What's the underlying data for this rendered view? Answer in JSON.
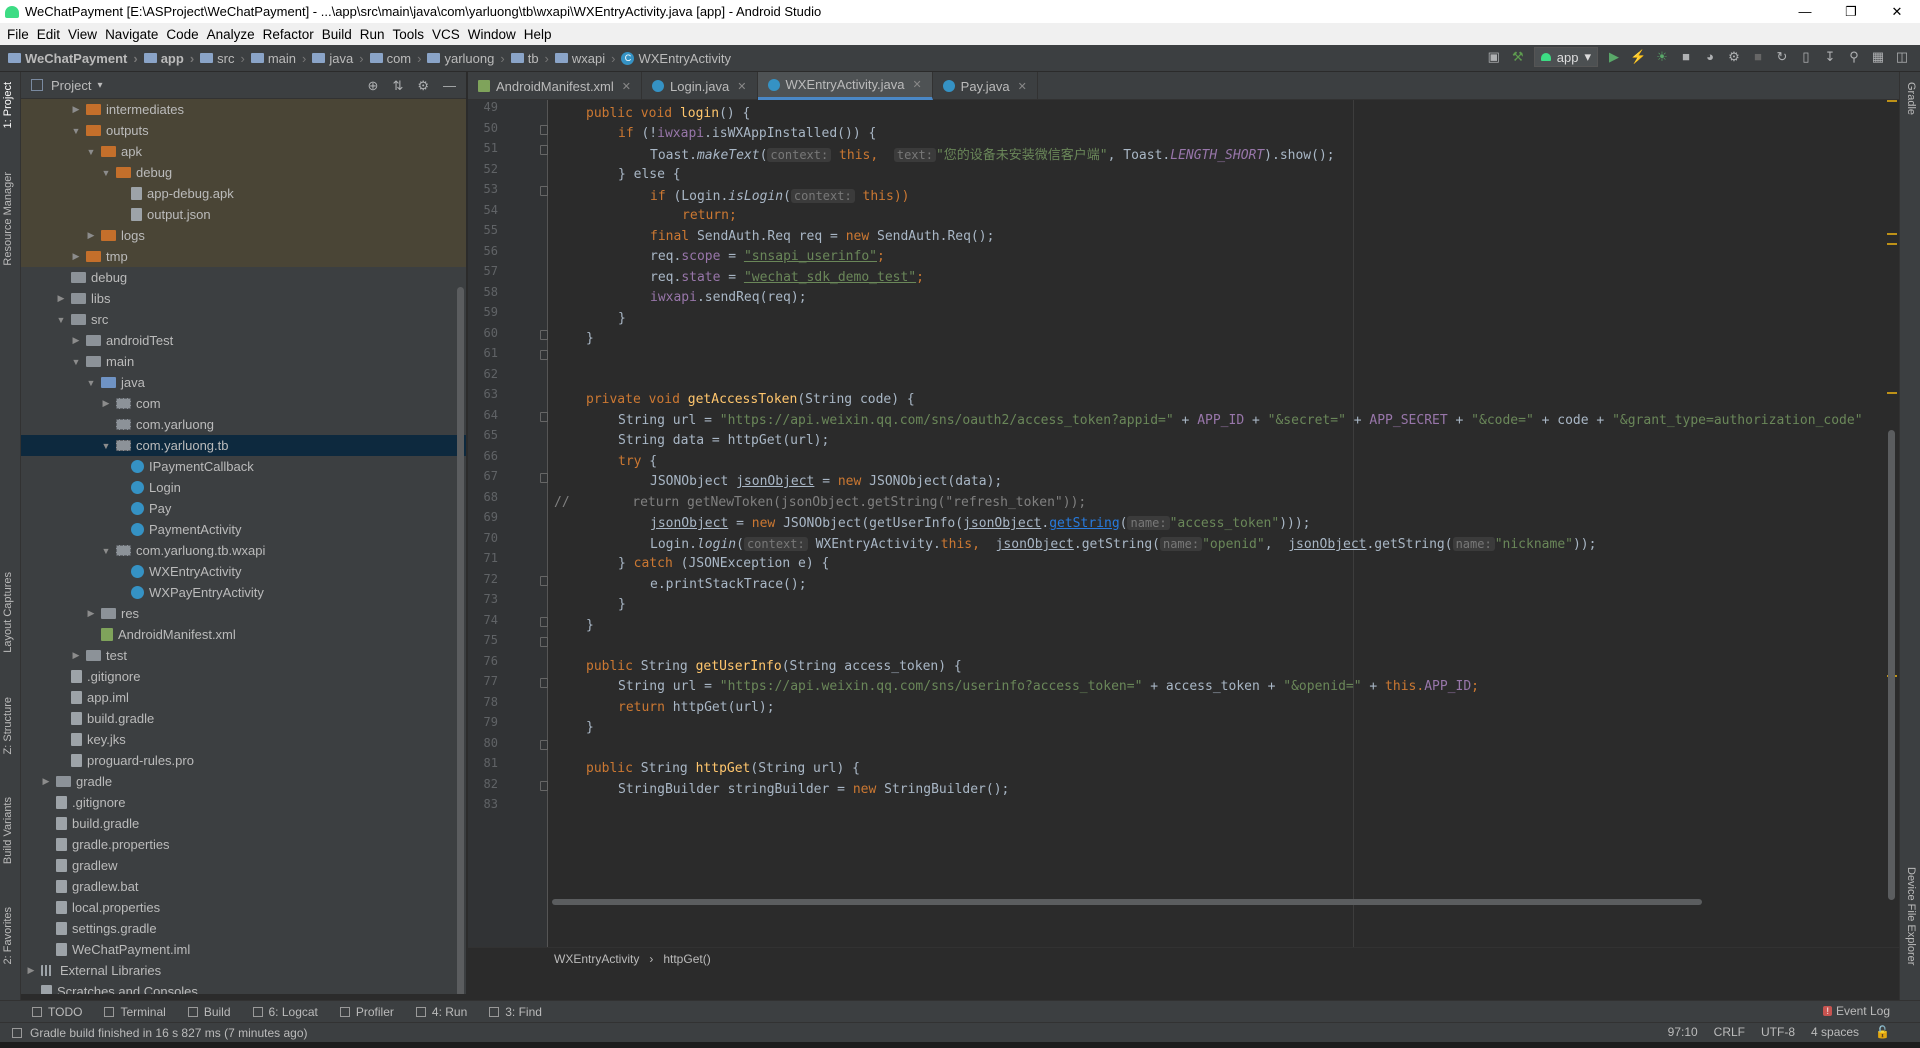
{
  "window": {
    "title": "WeChatPayment [E:\\ASProject\\WeChatPayment] - ...\\app\\src\\main\\java\\com\\yarluong\\tb\\wxapi\\WXEntryActivity.java [app] - Android Studio"
  },
  "menu": [
    "File",
    "Edit",
    "View",
    "Navigate",
    "Code",
    "Analyze",
    "Refactor",
    "Build",
    "Run",
    "Tools",
    "VCS",
    "Window",
    "Help"
  ],
  "breadcrumbs": [
    "WeChatPayment",
    "app",
    "src",
    "main",
    "java",
    "com",
    "yarluong",
    "tb",
    "wxapi",
    "WXEntryActivity"
  ],
  "run_config": "app",
  "left_tool_tabs": [
    "1: Project",
    "Resource Manager",
    "Layout Captures",
    "Z: Structure",
    "Build Variants",
    "2: Favorites"
  ],
  "right_tool_tabs": [
    "Gradle",
    "Device File Explorer"
  ],
  "project_panel": {
    "title": "Project",
    "tree": [
      {
        "label": "intermediates",
        "icon": "folder-orange",
        "arrow": "right"
      },
      {
        "label": "outputs",
        "icon": "folder-orange",
        "arrow": "down"
      },
      {
        "label": "apk",
        "icon": "folder-orange",
        "arrow": "down"
      },
      {
        "label": "debug",
        "icon": "folder-orange",
        "arrow": "down"
      },
      {
        "label": "app-debug.apk",
        "icon": "file",
        "arrow": ""
      },
      {
        "label": "output.json",
        "icon": "file",
        "arrow": ""
      },
      {
        "label": "logs",
        "icon": "folder-orange",
        "arrow": "right"
      },
      {
        "label": "tmp",
        "icon": "folder-orange",
        "arrow": "right"
      },
      {
        "label": "debug",
        "icon": "folder-gray",
        "arrow": ""
      },
      {
        "label": "libs",
        "icon": "folder-gray",
        "arrow": "right"
      },
      {
        "label": "src",
        "icon": "folder-gray",
        "arrow": "down"
      },
      {
        "label": "androidTest",
        "icon": "folder-gray",
        "arrow": "right"
      },
      {
        "label": "main",
        "icon": "folder-gray",
        "arrow": "down"
      },
      {
        "label": "java",
        "icon": "folder-blue",
        "arrow": "down"
      },
      {
        "label": "com",
        "icon": "package",
        "arrow": "right"
      },
      {
        "label": "com.yarluong",
        "icon": "package",
        "arrow": ""
      },
      {
        "label": "com.yarluong.tb",
        "icon": "package",
        "arrow": "down"
      },
      {
        "label": "IPaymentCallback",
        "icon": "class",
        "arrow": ""
      },
      {
        "label": "Login",
        "icon": "class",
        "arrow": ""
      },
      {
        "label": "Pay",
        "icon": "class",
        "arrow": ""
      },
      {
        "label": "PaymentActivity",
        "icon": "class",
        "arrow": ""
      },
      {
        "label": "com.yarluong.tb.wxapi",
        "icon": "package",
        "arrow": "down"
      },
      {
        "label": "WXEntryActivity",
        "icon": "class",
        "arrow": ""
      },
      {
        "label": "WXPayEntryActivity",
        "icon": "class",
        "arrow": ""
      },
      {
        "label": "res",
        "icon": "folder-gray",
        "arrow": "right"
      },
      {
        "label": "AndroidManifest.xml",
        "icon": "xml",
        "arrow": ""
      },
      {
        "label": "test",
        "icon": "folder-gray",
        "arrow": "right"
      },
      {
        "label": ".gitignore",
        "icon": "file",
        "arrow": ""
      },
      {
        "label": "app.iml",
        "icon": "file",
        "arrow": ""
      },
      {
        "label": "build.gradle",
        "icon": "file",
        "arrow": ""
      },
      {
        "label": "key.jks",
        "icon": "file",
        "arrow": ""
      },
      {
        "label": "proguard-rules.pro",
        "icon": "file",
        "arrow": ""
      },
      {
        "label": "gradle",
        "icon": "folder-gray",
        "arrow": "right"
      },
      {
        "label": ".gitignore",
        "icon": "file",
        "arrow": ""
      },
      {
        "label": "build.gradle",
        "icon": "file",
        "arrow": ""
      },
      {
        "label": "gradle.properties",
        "icon": "file",
        "arrow": ""
      },
      {
        "label": "gradlew",
        "icon": "file",
        "arrow": ""
      },
      {
        "label": "gradlew.bat",
        "icon": "file",
        "arrow": ""
      },
      {
        "label": "local.properties",
        "icon": "file",
        "arrow": ""
      },
      {
        "label": "settings.gradle",
        "icon": "file",
        "arrow": ""
      },
      {
        "label": "WeChatPayment.iml",
        "icon": "file",
        "arrow": ""
      },
      {
        "label": "External Libraries",
        "icon": "library",
        "arrow": "right"
      },
      {
        "label": "Scratches and Consoles",
        "icon": "file",
        "arrow": ""
      }
    ]
  },
  "tabs": [
    {
      "label": "AndroidManifest.xml",
      "type": "xml",
      "active": false
    },
    {
      "label": "Login.java",
      "type": "class",
      "active": false
    },
    {
      "label": "WXEntryActivity.java",
      "type": "class",
      "active": true
    },
    {
      "label": "Pay.java",
      "type": "class",
      "active": false
    }
  ],
  "code": {
    "line_numbers": [
      "49",
      "50",
      "51",
      "52",
      "53",
      "54",
      "55",
      "56",
      "57",
      "58",
      "59",
      "60",
      "61",
      "62",
      "63",
      "64",
      "65",
      "66",
      "67",
      "68",
      "69",
      "70",
      "71",
      "72",
      "73",
      "74",
      "75",
      "76",
      "77",
      "78",
      "79",
      "80",
      "81",
      "82",
      "83"
    ],
    "t": {
      "public": "public",
      "void": "void",
      "login": "login",
      "if": "if",
      "not": "(!",
      "iwxapi": "iwxapi",
      "installed": ".isWXAppInstalled()) {",
      "toast": "Toast.",
      "makeText": "makeText",
      "paren": "(",
      "context_hint": "context:",
      "this": "this",
      "comma": ",",
      "text_hint": "text:",
      "msg": "\"您的设备未安装微信客户端\"",
      "toast2": ", Toast.",
      "length_short": "LENGTH_SHORT",
      "show": ").show();",
      "close_else": "} else {",
      "login_cls": "(Login.",
      "isLogin": "isLogin",
      "this_close": "this))",
      "return": "return",
      "semi": ";",
      "final": "final",
      "sendauth": "SendAuth.Req req = ",
      "new": "new",
      "sendauth2": "SendAuth.Req();",
      "req": "req.",
      "scope": "scope",
      "eq": " = ",
      "scope_val": "\"snsapi_userinfo\"",
      "state": "state",
      "state_val": "\"wechat_sdk_demo_test\"",
      "sendreq": ".sendReq(req);",
      "close": "}",
      "private": "private",
      "getAccessToken": "getAccessToken",
      "gat_args": "(String code) {",
      "string_url": "String url = ",
      "url1": "\"https://api.weixin.qq.com/sns/oauth2/access_token?appid=\"",
      "plus": " + ",
      "app_id": "APP_ID",
      "secret": "\"&secret=\"",
      "app_secret": "APP_SECRET",
      "code_param": "\"&code=\"",
      "code_var": "code",
      "grant": "\"&grant_type=authorization_code\"",
      "string_data": "String data = httpGet(url);",
      "try": "try",
      "open": " {",
      "jsonobj": "JSONObject ",
      "jsonObject": "jsonObject",
      "jsonobj2": " JSONObject(data);",
      "comment": "//",
      "commented": "        return getNewToken(jsonObject.getString(\"refresh_token\"));",
      "new_json": " JSONObject(getUserInfo(",
      "getString": "getString",
      "dot": ".",
      "name_hint": "name:",
      "access_token": "\"access_token\"",
      "close3": ")));",
      "login_call": "Login.",
      "login_fn": "login",
      "wxentry_this": "WXEntryActivity.",
      "getString2": ".getString(",
      "openid": "\"openid\"",
      "nickname": "\"nickname\"",
      "close2": "));",
      "catch": "catch",
      "catch_args": " (JSONException e) {",
      "print": "e.printStackTrace();",
      "string_type": "String",
      "getUserInfo": "getUserInfo",
      "gui_args": "(String access_token) {",
      "url2": "\"https://api.weixin.qq.com/sns/userinfo?access_token=\"",
      "access_token_var": "access_token",
      "openid_param": "\"&openid=\"",
      "this_dot": "this.",
      "return_http": " httpGet(url);",
      "httpGet": "httpGet",
      "hg_args": "(String url) {",
      "sb": "StringBuilder stringBuilder = ",
      "sb2": " StringBuilder();"
    }
  },
  "editor_breadcrumb": [
    "WXEntryActivity",
    "httpGet()"
  ],
  "bottom_tools": [
    "TODO",
    "Terminal",
    "Build",
    "6: Logcat",
    "Profiler",
    "4: Run",
    "3: Find"
  ],
  "event_log": "Event Log",
  "status": {
    "message": "Gradle build finished in 16 s 827 ms (7 minutes ago)",
    "position": "97:10",
    "line_sep": "CRLF",
    "encoding": "UTF-8",
    "indent": "4 spaces"
  }
}
